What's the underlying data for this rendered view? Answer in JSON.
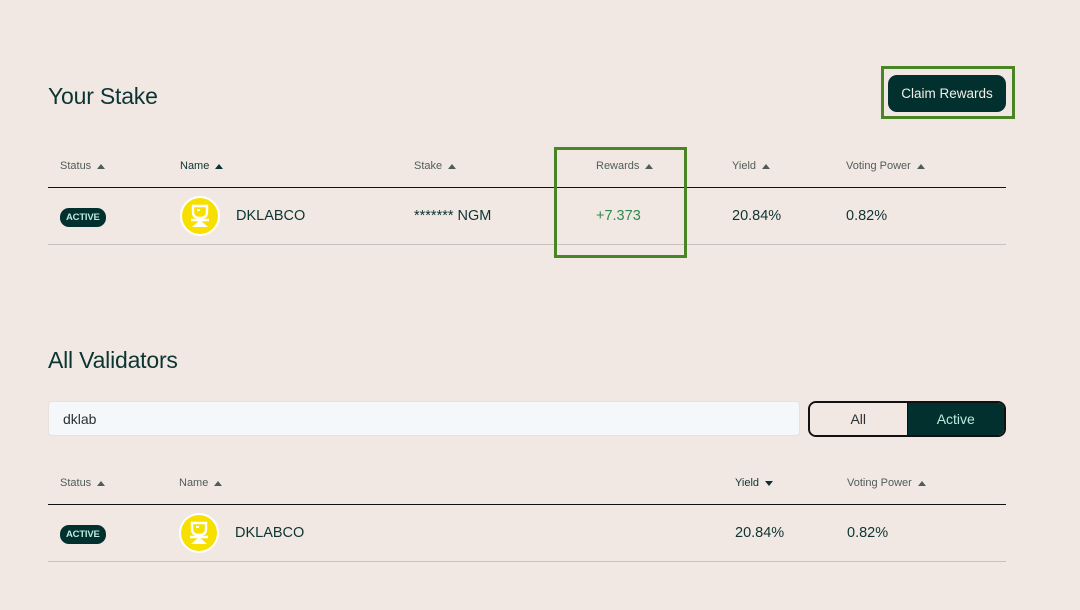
{
  "stake_section": {
    "title": "Your Stake",
    "claim_button": "Claim Rewards",
    "columns": {
      "status": "Status",
      "name": "Name",
      "stake": "Stake",
      "rewards": "Rewards",
      "yield": "Yield",
      "voting_power": "Voting Power"
    },
    "rows": [
      {
        "status": "ACTIVE",
        "name": "DKLABCO",
        "stake": "******* NGM",
        "rewards": "+7.373",
        "yield": "20.84%",
        "voting_power": "0.82%"
      }
    ]
  },
  "validators_section": {
    "title": "All Validators",
    "search": {
      "value": "dklab",
      "placeholder": ""
    },
    "filter": {
      "options": [
        "All",
        "Active"
      ],
      "selected": "Active"
    },
    "columns": {
      "status": "Status",
      "name": "Name",
      "yield": "Yield",
      "voting_power": "Voting Power"
    },
    "sort": {
      "column": "yield",
      "direction": "desc"
    },
    "rows": [
      {
        "status": "ACTIVE",
        "name": "DKLABCO",
        "yield": "20.84%",
        "voting_power": "0.82%"
      }
    ]
  },
  "colors": {
    "background": "#f2e8e3",
    "primary": "#02302f",
    "rewards_positive": "#2d8a4e",
    "highlight": "#4a8525",
    "avatar": "#f7e000"
  }
}
